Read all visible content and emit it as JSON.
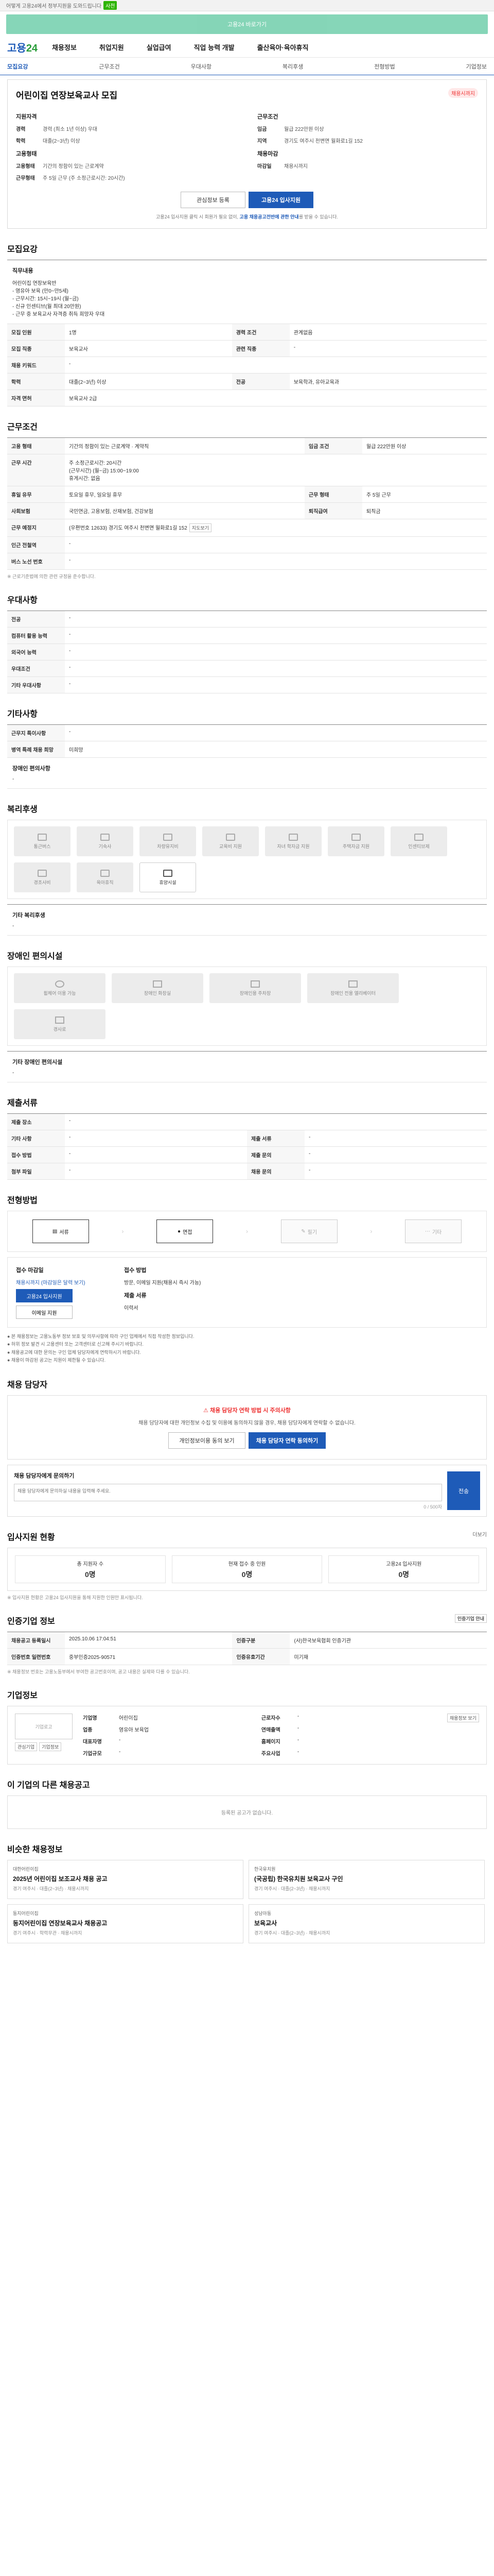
{
  "topbar": {
    "text": "어떻게 고용24에서 정부지원을 도와드립니다",
    "tag": "사전"
  },
  "banner": {
    "text": "고용24 바로가기"
  },
  "gnb": {
    "logo_a": "고용",
    "logo_b": "24",
    "items": [
      "채용정보",
      "취업지원",
      "실업급여",
      "직업 능력 개발",
      "출산육아·육아휴직"
    ]
  },
  "tabs": [
    "모집요강",
    "근무조건",
    "우대사항",
    "복리후생",
    "전형방법",
    "기업정보"
  ],
  "summary": {
    "title": "어린이집 연장보육교사 모집",
    "badge": "채용시까지",
    "left_h": "지원자격",
    "left": [
      [
        "경력",
        "경력 (최소 1년 이상) 우대"
      ],
      [
        "학력",
        "대졸(2~3년) 이상"
      ]
    ],
    "right_h": "근무조건",
    "right": [
      [
        "임금",
        "월급 222만원 이상"
      ],
      [
        "지역",
        "경기도 여주시 천변면 월화로1길 152"
      ]
    ],
    "left2_h": "고용형태",
    "left2": [
      [
        "고용형태",
        "기간의 정함이 있는 근로계약"
      ],
      [
        "근무형태",
        "주 5일 근무 (주 소정근로시간: 20시간)"
      ]
    ],
    "right2_h": "채용마감",
    "right2": [
      [
        "마감일",
        "채용시까지"
      ]
    ],
    "btn_scrap": "관심정보 등록",
    "btn_apply": "고용24 입사지원",
    "note": "고용24 입사지원 클릭 시 회원가 필요 없이,",
    "note_b": "고용 채용공고전반에 관한 안내",
    "note2": "를 받을 수 있습니다."
  },
  "recruit": {
    "title": "모집요강",
    "duty_h": "직무내용",
    "duty": [
      "어린이집 연장보육반",
      "- 영유아 보육 (만0~만5세)",
      "- 근무시간: 15시~19시 (월~금)",
      "- 신규 인센티브(월 최대 20만원)",
      "- 근무 중 보육교사 자격증 취득 희망자 우대"
    ],
    "rows": [
      [
        "모집 인원",
        "1명",
        "경력 조건",
        "관계없음"
      ],
      [
        "모집 직종",
        "보육교사",
        "관련 직종",
        "-"
      ],
      [
        "채용 키워드",
        "-",
        "",
        ""
      ],
      [
        "학력",
        "대졸(2~3년) 이상",
        "전공",
        "보육학과, 유아교육과"
      ],
      [
        "자격 면허",
        "보육교사 2급",
        "",
        ""
      ]
    ]
  },
  "work": {
    "title": "근무조건",
    "r1": [
      "고용 형태",
      "기간의 정함이 있는 근로계약 · 계약직",
      "임금 조건",
      "월급 222만원 이상"
    ],
    "addr_h": "근무 예정지",
    "addr": "(우편번호 12633) 경기도 여주시 천변면 월화로1길 152",
    "addr_sub": "지도보기",
    "time_h": "근무 시간",
    "time": [
      "주 소정근로시간: 20시간",
      "(근무시간) (월~금) 15:00~19:00",
      "휴게시간: 없음"
    ],
    "r2": [
      "휴일 유무",
      "토요일 휴무, 일요일 휴무",
      "근무 형태",
      "주 5일 근무"
    ],
    "r3": [
      "사회보험",
      "국민연금, 고용보험, 산재보험, 건강보험",
      "퇴직급여",
      "퇴직금"
    ],
    "r4": [
      "근무 예정지",
      "경기도 여주시 천변면 월화로1길 152",
      "",
      ""
    ],
    "r5": [
      "인근 전철역",
      "-"
    ],
    "r6": [
      "버스 노선 번호",
      "-"
    ],
    "foot": "※ 근로기준법에 의한 관련 규정을 준수합니다."
  },
  "prefer": {
    "title": "우대사항",
    "rows": [
      [
        "전공",
        "-"
      ],
      [
        "컴퓨터 활용 능력",
        "-"
      ],
      [
        "외국어 능력",
        "-"
      ],
      [
        "우대조건",
        "-"
      ],
      [
        "기타 우대사항",
        "-"
      ]
    ]
  },
  "other": {
    "title": "기타사항",
    "rows": [
      [
        "근무지 특이사항",
        "-"
      ],
      [
        "병역 특례 채용 희망",
        "미희망"
      ]
    ],
    "subhead": "장애인 편의사항",
    "sub": "-"
  },
  "welfare": {
    "title": "복리후생",
    "tiles": [
      "통근버스",
      "기숙사",
      "차량유지비",
      "교육비 지원",
      "자녀 학자금 지원",
      "주택자금 지원",
      "인센티브제",
      "경조사비",
      "육아휴직",
      "휴양시설"
    ],
    "on_index": 9,
    "etc_h": "기타 복리후생",
    "etc": "-"
  },
  "disabled": {
    "title": "장애인 편의시설",
    "tiles": [
      "휠체어 이용 가능",
      "장애인 화장실",
      "장애인용 주차장",
      "장애인 전용 엘리베이터",
      "경사로"
    ],
    "etc_h": "기타 장애인 편의시설",
    "etc": "-"
  },
  "submit": {
    "title": "제출서류",
    "rows": [
      [
        "제출 장소",
        "-",
        "",
        ""
      ],
      [
        "기타 사항",
        "-",
        "제출 서류",
        "-"
      ],
      [
        "접수 방법",
        "-",
        "제출 문의",
        "-"
      ],
      [
        "첨부 파일",
        "-",
        "채용 문의",
        "-"
      ]
    ]
  },
  "process": {
    "title": "전형방법",
    "steps": [
      "서류",
      "면접",
      "필기",
      "기타"
    ],
    "on": [
      0,
      1
    ],
    "apply_h": "접수 마감일",
    "apply_v": "채용시까지 (마감일은 달력 보기)",
    "btn_apply": "고용24 입사지원",
    "btn_mail": "이메일 지원",
    "method_h": "접수 방법",
    "method": "방문, 이메일 지원(채용시 즉시 가능)",
    "doc_h": "제출 서류",
    "doc": "이력서",
    "notes": [
      "● 본 채용정보는 고용노동부 정보 보호 및 의무사항에 따라 구인 업체에서 직접 작성한 정보입니다.",
      "● 허위 정보 발견 시 고용센터 또는 고객센터로 신고해 주시기 바랍니다.",
      "● 채용공고에 대한 문의는 구인 업체 담당자에게 연락하시기 바랍니다.",
      "● 채용이 마감된 공고는 지원이 제한될 수 있습니다."
    ]
  },
  "qa": {
    "title": "채용 담당자",
    "warn": "채용 담당자 연락 방법 시 주의사항",
    "txt": "채용 담당자에 대한 개인정보 수집 및 이용에 동의하지 않을 경우, 채용 담당자에게 연락할 수 없습니다.",
    "btn1": "개인정보이용 동의 보기",
    "btn2": "채용 담당자 연락 동의하기",
    "input_h": "채용 담당자에게 문의하기",
    "placeholder": "채용 담당자에게 문의하실 내용을 입력해 주세요.",
    "count": "0 / 500자",
    "send": "전송"
  },
  "stats": {
    "title": "입사지원 현황",
    "more": "더보기",
    "items": [
      [
        "총 지원자 수",
        "0명"
      ],
      [
        "현재 접수 중 인원",
        "0명"
      ],
      [
        "고용24 입사지원",
        "0명"
      ]
    ],
    "note": "※ 입사지원 현황은 고용24 입사지원을 통해 지원한 인원만 표시됩니다."
  },
  "info": {
    "title": "인증기업 정보",
    "btn": "인증기업 안내",
    "r1": [
      "채용공고 등록일시",
      "2025.10.06 17:04:51",
      "인증구분",
      "(사)한국보육협회 인증기관"
    ],
    "r2": [
      "인증번호 일련번호",
      "중부인증2025-90571",
      "인증유효기간",
      "미기재"
    ],
    "note": "※ 채용정보 번호는 고용노동부에서 부여한 공고번호이며, 공고 내용은 실제와 다를 수 있습니다."
  },
  "corp": {
    "title": "기업정보",
    "logo": "기업로고",
    "btn_a": "관심기업",
    "btn_b": "기업정보",
    "k": [
      "기업명",
      "업종",
      "대표자명",
      "기업규모"
    ],
    "v": [
      "어린이집",
      "영유아 보육업",
      "-",
      "-"
    ],
    "k2": [
      "근로자수",
      "연매출액",
      "홈페이지",
      "주요사업"
    ],
    "v2": [
      "-",
      "-",
      "-",
      "-"
    ],
    "btn": "채용정보 보기"
  },
  "similar": {
    "title": "이 기업의 다른 채용공고",
    "empty": "등록된 공고가 없습니다.",
    "title2": "비슷한 채용정보",
    "cards": [
      {
        "co": "대한어린이집",
        "title": "2025년 어린이집 보조교사 채용 공고",
        "meta": "경기 여주시 · 대졸(2~3년) · 채용시까지"
      },
      {
        "co": "한국유치원",
        "title": "(국공립) 한국유치원 보육교사 구인",
        "meta": "경기 여주시 · 대졸(2~3년) · 채용시까지"
      },
      {
        "co": "동지어린이집",
        "title": "동지어린이집 연장보육교사 채용공고",
        "meta": "경기 여주시 · 학력무관 · 채용시까지"
      },
      {
        "co": "성남아동",
        "title": "보육교사",
        "meta": "경기 여주시 · 대졸(2~3년) · 채용시까지"
      }
    ]
  },
  "colors": {
    "accent": "#1e5bb8",
    "green": "#2db400",
    "warn": "#e33333"
  }
}
